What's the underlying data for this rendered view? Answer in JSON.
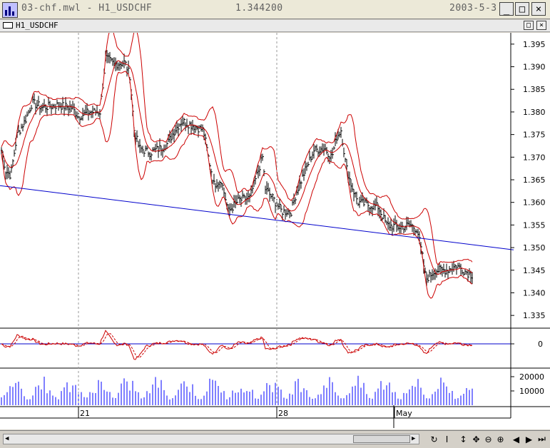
{
  "window": {
    "title_left": "03-chf.mwl - H1_USDCHF",
    "price": "1.344200",
    "date": "2003-5-3",
    "minimize_label": "_",
    "maximize_label": "□",
    "close_label": "×"
  },
  "chart_window": {
    "title": "H1_USDCHF",
    "restore_label": "□",
    "close_label": "×"
  },
  "chart_data": {
    "type": "line",
    "symbol": "H1_USDCHF",
    "price_axis": {
      "ticks": [
        "1.395",
        "1.390",
        "1.385",
        "1.380",
        "1.375",
        "1.370",
        "1.365",
        "1.360",
        "1.355",
        "1.350",
        "1.345",
        "1.340",
        "1.335"
      ],
      "ylim": [
        1.3325,
        1.3975
      ]
    },
    "oscillator_axis": {
      "ticks": [
        "0"
      ]
    },
    "volume_axis": {
      "ticks": [
        "20000",
        "10000"
      ],
      "ylim": [
        0,
        25000
      ]
    },
    "time_labels": [
      "21",
      "28",
      "May"
    ],
    "trendline": {
      "color": "#0000cc",
      "from": [
        0,
        1.3637
      ],
      "to": [
        720,
        1.3495
      ]
    },
    "price_anchors": [
      [
        0,
        1.373
      ],
      [
        8,
        1.367
      ],
      [
        15,
        1.366
      ],
      [
        24,
        1.375
      ],
      [
        35,
        1.378
      ],
      [
        45,
        1.382
      ],
      [
        60,
        1.381
      ],
      [
        80,
        1.3815
      ],
      [
        100,
        1.381
      ],
      [
        110,
        1.379
      ],
      [
        125,
        1.38
      ],
      [
        140,
        1.38
      ],
      [
        148,
        1.392
      ],
      [
        160,
        1.3905
      ],
      [
        175,
        1.391
      ],
      [
        182,
        1.388
      ],
      [
        188,
        1.376
      ],
      [
        195,
        1.372
      ],
      [
        210,
        1.371
      ],
      [
        225,
        1.372
      ],
      [
        235,
        1.373
      ],
      [
        245,
        1.376
      ],
      [
        255,
        1.378
      ],
      [
        270,
        1.377
      ],
      [
        285,
        1.376
      ],
      [
        292,
        1.37
      ],
      [
        300,
        1.364
      ],
      [
        310,
        1.365
      ],
      [
        320,
        1.358
      ],
      [
        335,
        1.3605
      ],
      [
        350,
        1.361
      ],
      [
        360,
        1.366
      ],
      [
        368,
        1.37
      ],
      [
        372,
        1.363
      ],
      [
        382,
        1.361
      ],
      [
        395,
        1.358
      ],
      [
        408,
        1.358
      ],
      [
        415,
        1.362
      ],
      [
        425,
        1.366
      ],
      [
        440,
        1.3715
      ],
      [
        455,
        1.372
      ],
      [
        465,
        1.37
      ],
      [
        472,
        1.3745
      ],
      [
        478,
        1.376
      ],
      [
        485,
        1.368
      ],
      [
        492,
        1.364
      ],
      [
        502,
        1.36
      ],
      [
        515,
        1.3595
      ],
      [
        530,
        1.359
      ],
      [
        542,
        1.355
      ],
      [
        560,
        1.3545
      ],
      [
        575,
        1.355
      ],
      [
        585,
        1.354
      ],
      [
        592,
        1.348
      ],
      [
        597,
        1.343
      ],
      [
        610,
        1.345
      ],
      [
        625,
        1.345
      ],
      [
        640,
        1.346
      ],
      [
        650,
        1.345
      ],
      [
        660,
        1.344
      ]
    ],
    "volume_color": "#0000ff",
    "band_color": "#cc0000",
    "oscillator_color": "#cc0000"
  },
  "toolbar": {
    "refresh_icon": "↻",
    "cursor_icon": "I",
    "updown_icon": "↕",
    "arrows_icon": "✥",
    "zoom_out_icon": "⊖",
    "zoom_in_icon": "⊕",
    "prev_icon": "◀",
    "next_icon": "▶",
    "end_icon": "⏭"
  }
}
